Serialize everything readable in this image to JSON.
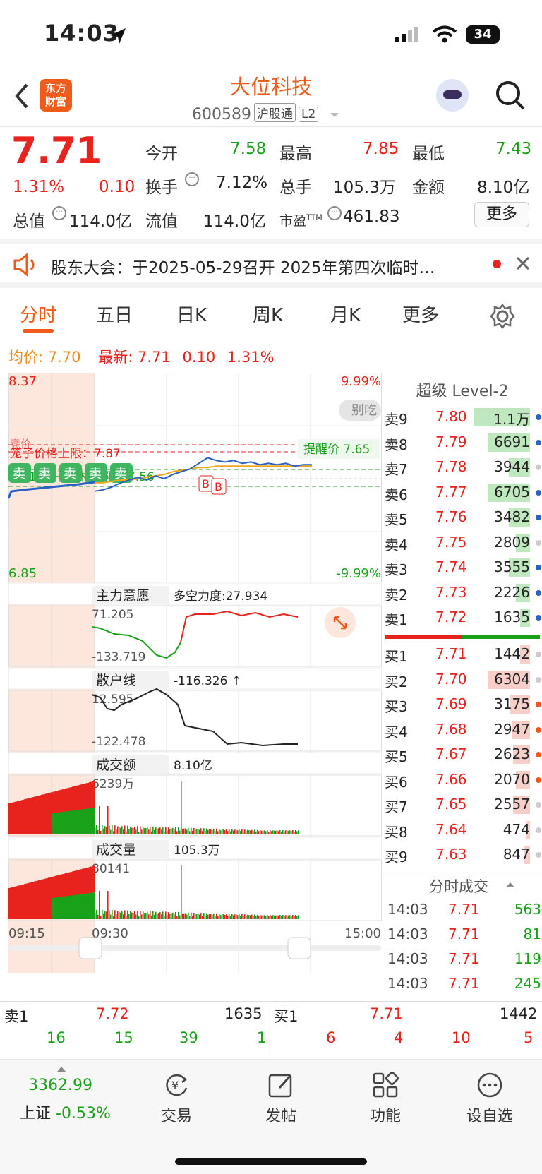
{
  "status": {
    "time": "14:03",
    "battery": "34"
  },
  "header": {
    "logo_line1": "东方",
    "logo_line2": "财富",
    "stock_name": "大位科技",
    "stock_code": "600589",
    "tag1": "沪股通",
    "tag2": "L2"
  },
  "quote": {
    "price": "7.71",
    "change_pct": "1.31%",
    "change": "0.10",
    "open_label": "今开",
    "open": "7.58",
    "high_label": "最高",
    "high": "7.85",
    "low_label": "最低",
    "low": "7.43",
    "turnover_label": "换手",
    "turnover": "7.12%",
    "volume_label": "总手",
    "volume": "105.3万",
    "amount_label": "金额",
    "amount": "8.10亿",
    "mktcap_label": "总值",
    "mktcap": "114.0亿",
    "float_label": "流值",
    "float": "114.0亿",
    "pe_label": "市盈",
    "pe_sup": "TTM",
    "pe": "461.83",
    "more": "更多"
  },
  "notice": {
    "text": "股东大会：于2025-05-29召开 2025年第四次临时…"
  },
  "tabs": [
    "分时",
    "五日",
    "日K",
    "周K",
    "月K",
    "更多"
  ],
  "summary": {
    "avg_label": "均价:",
    "avg": "7.70",
    "latest_label": "最新:",
    "latest": "7.71",
    "change": "0.10",
    "pct": "1.31%"
  },
  "chart_data": {
    "type": "line",
    "title": "",
    "price_top": "8.37",
    "price_bottom": "6.85",
    "pct_top": "9.99%",
    "pct_bottom": "-9.99%",
    "x_labels": [
      "09:15",
      "09:30",
      "15:00"
    ],
    "pre_label": "竞价",
    "upper_line_label": "笼子价格上限：7.87",
    "lower_line_label": "笼子价格下限：7.56",
    "lower_val": "7.61",
    "alert_label": "提醒价 7.65",
    "sell_badge": "卖",
    "buy_badge": "B",
    "other_label": "别吃",
    "price_series": [
      7.52,
      7.53,
      7.55,
      7.58,
      7.6,
      7.62,
      7.6,
      7.63,
      7.61,
      7.64,
      7.66,
      7.68,
      7.72,
      7.76,
      7.74,
      7.73,
      7.74,
      7.72,
      7.73,
      7.71,
      7.72,
      7.71,
      7.72,
      7.7,
      7.71,
      7.71
    ],
    "avg_series": [
      7.58,
      7.58,
      7.59,
      7.6,
      7.6,
      7.61,
      7.62,
      7.63,
      7.64,
      7.66,
      7.67,
      7.68,
      7.69,
      7.69,
      7.7,
      7.7,
      7.7,
      7.7,
      7.7,
      7.7,
      7.7,
      7.7,
      7.7,
      7.7,
      7.7,
      7.7
    ]
  },
  "indicators": {
    "main_name": "主力意愿",
    "main_value": "多空力度:27.934",
    "main_top": "71.205",
    "main_bottom": "-133.719",
    "retail_name": "散户线",
    "retail_value": "-116.326 ↑",
    "retail_top": "12.595",
    "retail_bottom": "-122.478",
    "amount_name": "成交额",
    "amount_value": "8.10亿",
    "amount_peak": "6239万",
    "vol_name": "成交量",
    "vol_value": "105.3万",
    "vol_peak": "80141"
  },
  "level2": {
    "title": "超级 Level-2",
    "asks": [
      {
        "label": "卖9",
        "price": "7.80",
        "vol": "1.1万",
        "bar": 0.4
      },
      {
        "label": "卖8",
        "price": "7.79",
        "vol": "6691",
        "bar": 0.3
      },
      {
        "label": "卖7",
        "price": "7.78",
        "vol": "3944",
        "bar": 0.15
      },
      {
        "label": "卖6",
        "price": "7.77",
        "vol": "6705",
        "bar": 0.3
      },
      {
        "label": "卖5",
        "price": "7.76",
        "vol": "3482",
        "bar": 0.15
      },
      {
        "label": "卖4",
        "price": "7.75",
        "vol": "2809",
        "bar": 0.1
      },
      {
        "label": "卖3",
        "price": "7.74",
        "vol": "3555",
        "bar": 0.15
      },
      {
        "label": "卖2",
        "price": "7.73",
        "vol": "2226",
        "bar": 0.1
      },
      {
        "label": "卖1",
        "price": "7.72",
        "vol": "1635",
        "bar": 0.07
      }
    ],
    "bids": [
      {
        "label": "买1",
        "price": "7.71",
        "vol": "1442",
        "bar": 0.07
      },
      {
        "label": "买2",
        "price": "7.70",
        "vol": "6304",
        "bar": 0.3
      },
      {
        "label": "买3",
        "price": "7.69",
        "vol": "3175",
        "bar": 0.14
      },
      {
        "label": "买4",
        "price": "7.68",
        "vol": "2947",
        "bar": 0.13
      },
      {
        "label": "买5",
        "price": "7.67",
        "vol": "2623",
        "bar": 0.12
      },
      {
        "label": "买6",
        "price": "7.66",
        "vol": "2070",
        "bar": 0.1
      },
      {
        "label": "买7",
        "price": "7.65",
        "vol": "2557",
        "bar": 0.12
      },
      {
        "label": "买8",
        "price": "7.64",
        "vol": "474",
        "bar": 0.03
      },
      {
        "label": "买9",
        "price": "7.63",
        "vol": "847",
        "bar": 0.04
      }
    ],
    "ticks_title": "分时成交",
    "ticks": [
      {
        "time": "14:03",
        "price": "7.71",
        "vol": "563"
      },
      {
        "time": "14:03",
        "price": "7.71",
        "vol": "81"
      },
      {
        "time": "14:03",
        "price": "7.71",
        "vol": "119"
      },
      {
        "time": "14:03",
        "price": "7.71",
        "vol": "245"
      }
    ]
  },
  "bottom_book": {
    "sell_label": "卖1",
    "sell_price": "7.72",
    "sell_vol": "1635",
    "buy_label": "买1",
    "buy_price": "7.71",
    "buy_vol": "1442",
    "sell_queue": [
      "16",
      "15",
      "39",
      "1"
    ],
    "buy_queue": [
      "6",
      "4",
      "10",
      "5"
    ]
  },
  "footer": {
    "index_value": "3362.99",
    "index_name": "上证",
    "index_pct": "-0.53%",
    "items": [
      "交易",
      "发帖",
      "功能",
      "设自选"
    ]
  }
}
